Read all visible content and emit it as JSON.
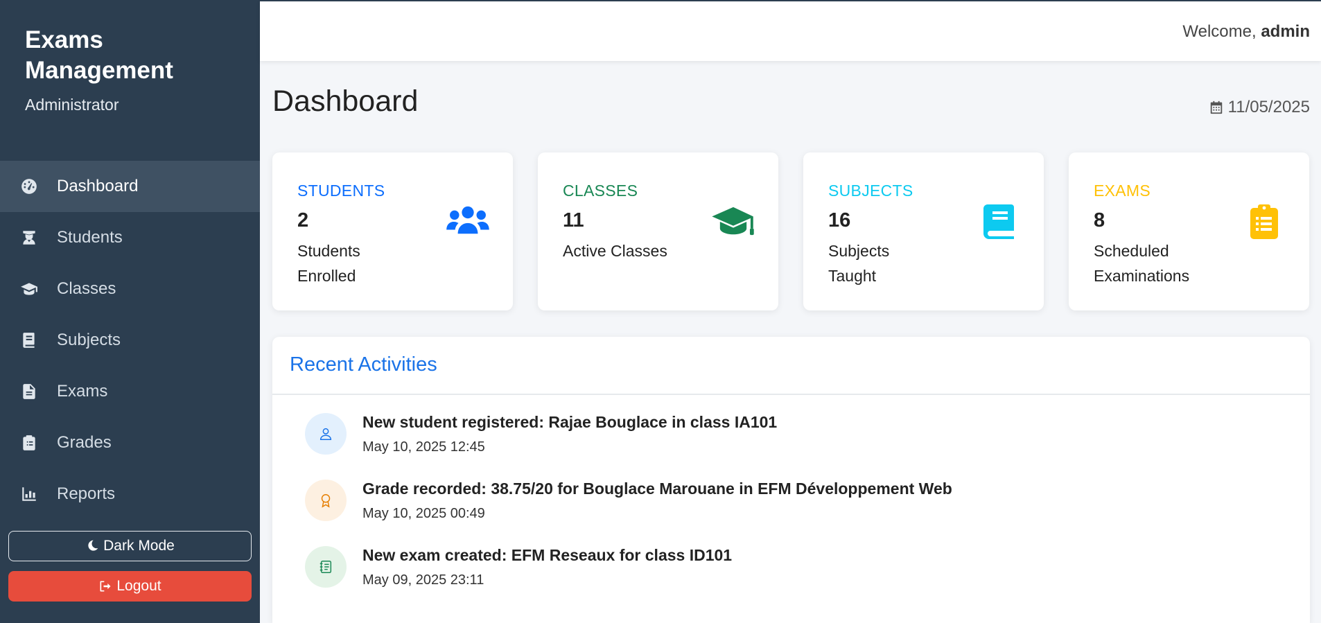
{
  "sidebar": {
    "brand_title": "Exams Management",
    "brand_role": "Administrator",
    "items": [
      {
        "label": "Dashboard",
        "icon": "gauge-icon",
        "active": true
      },
      {
        "label": "Students",
        "icon": "student-icon"
      },
      {
        "label": "Classes",
        "icon": "graduation-cap-icon"
      },
      {
        "label": "Subjects",
        "icon": "book-icon"
      },
      {
        "label": "Exams",
        "icon": "file-icon"
      },
      {
        "label": "Grades",
        "icon": "clipboard-icon"
      },
      {
        "label": "Reports",
        "icon": "chart-icon"
      }
    ],
    "dark_mode_label": "Dark Mode",
    "logout_label": "Logout"
  },
  "topbar": {
    "welcome_prefix": "Welcome,",
    "username": "admin"
  },
  "header": {
    "title": "Dashboard",
    "date": "11/05/2025"
  },
  "cards": [
    {
      "label": "STUDENTS",
      "value": "2",
      "desc": "Students Enrolled",
      "color": "#0d6efd",
      "icon": "users-icon"
    },
    {
      "label": "CLASSES",
      "value": "11",
      "desc": "Active Classes",
      "color": "#198754",
      "icon": "graduation-cap-icon"
    },
    {
      "label": "SUBJECTS",
      "value": "16",
      "desc": "Subjects Taught",
      "color": "#0dcaf0",
      "icon": "book-icon"
    },
    {
      "label": "EXAMS",
      "value": "8",
      "desc": "Scheduled Examinations",
      "color": "#ffc107",
      "icon": "clipboard-list-icon"
    }
  ],
  "activities": {
    "title": "Recent Activities",
    "items": [
      {
        "text": "New student registered: Rajae Bouglace in class IA101",
        "time": "May 10, 2025 12:45",
        "icon": "user-icon"
      },
      {
        "text": "Grade recorded: 38.75/20 for Bouglace Marouane in EFM Développement Web",
        "time": "May 10, 2025 00:49",
        "icon": "award-icon"
      },
      {
        "text": "New exam created: EFM Reseaux for class ID101",
        "time": "May 09, 2025 23:11",
        "icon": "journal-icon"
      }
    ]
  }
}
